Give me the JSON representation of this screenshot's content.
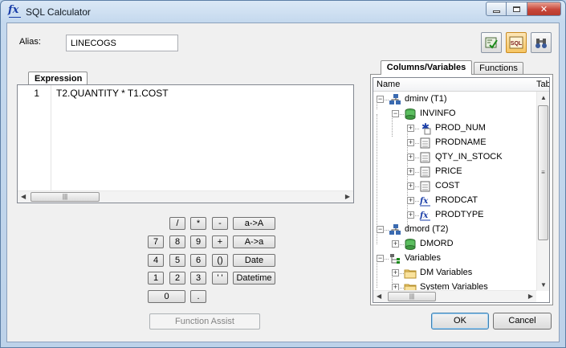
{
  "window": {
    "title": "SQL Calculator",
    "controls": {
      "minimize": "▭",
      "maximize": "□",
      "close": "✕"
    }
  },
  "alias": {
    "label": "Alias:",
    "value": "LINECOGS"
  },
  "toolbar": {
    "icons": [
      "validate-icon",
      "sql-icon",
      "find-icon"
    ],
    "sql_text": "SQL"
  },
  "expression": {
    "tab_label": "Expression",
    "line_number": "1",
    "code": "T2.QUANTITY * T1.COST",
    "scroll_thumb_grip": "|||"
  },
  "keypad": {
    "ops_row": [
      "/",
      "*",
      "-"
    ],
    "a_to_A": "a->A",
    "row1": [
      "7",
      "8",
      "9",
      "+"
    ],
    "A_to_a": "A->a",
    "row2": [
      "4",
      "5",
      "6",
      "()"
    ],
    "date": "Date",
    "row3": [
      "1",
      "2",
      "3",
      "' '"
    ],
    "datetime": "Datetime",
    "zero": "0",
    "dot": "."
  },
  "function_assist": "Function Assist",
  "right_panel": {
    "tabs": [
      "Columns/Variables",
      "Functions"
    ],
    "columns": [
      "Name",
      "Tab"
    ],
    "tree": [
      {
        "label": "dminv (T1)",
        "icon": "table-source-icon",
        "expander": "−"
      },
      {
        "label": "INVINFO",
        "icon": "database-icon",
        "expander": "−"
      },
      {
        "label": "PROD_NUM",
        "icon": "key-column-icon",
        "expander": "+"
      },
      {
        "label": "PRODNAME",
        "icon": "column-icon",
        "expander": "+"
      },
      {
        "label": "QTY_IN_STOCK",
        "icon": "column-icon",
        "expander": "+"
      },
      {
        "label": "PRICE",
        "icon": "column-icon",
        "expander": "+"
      },
      {
        "label": "COST",
        "icon": "column-icon",
        "expander": "+"
      },
      {
        "label": "PRODCAT",
        "icon": "formula-column-icon",
        "expander": "+"
      },
      {
        "label": "PRODTYPE",
        "icon": "formula-column-icon",
        "expander": "+"
      },
      {
        "label": "dmord (T2)",
        "icon": "table-source-icon",
        "expander": "−"
      },
      {
        "label": "DMORD",
        "icon": "database-icon",
        "expander": "+"
      },
      {
        "label": "Variables",
        "icon": "variables-icon",
        "expander": "−"
      },
      {
        "label": "DM Variables",
        "icon": "folder-icon",
        "expander": "+"
      },
      {
        "label": "System Variables",
        "icon": "folder-icon",
        "expander": "+"
      }
    ],
    "scroll_thumb_grip": "≡"
  },
  "buttons": {
    "ok": "OK",
    "cancel": "Cancel"
  }
}
